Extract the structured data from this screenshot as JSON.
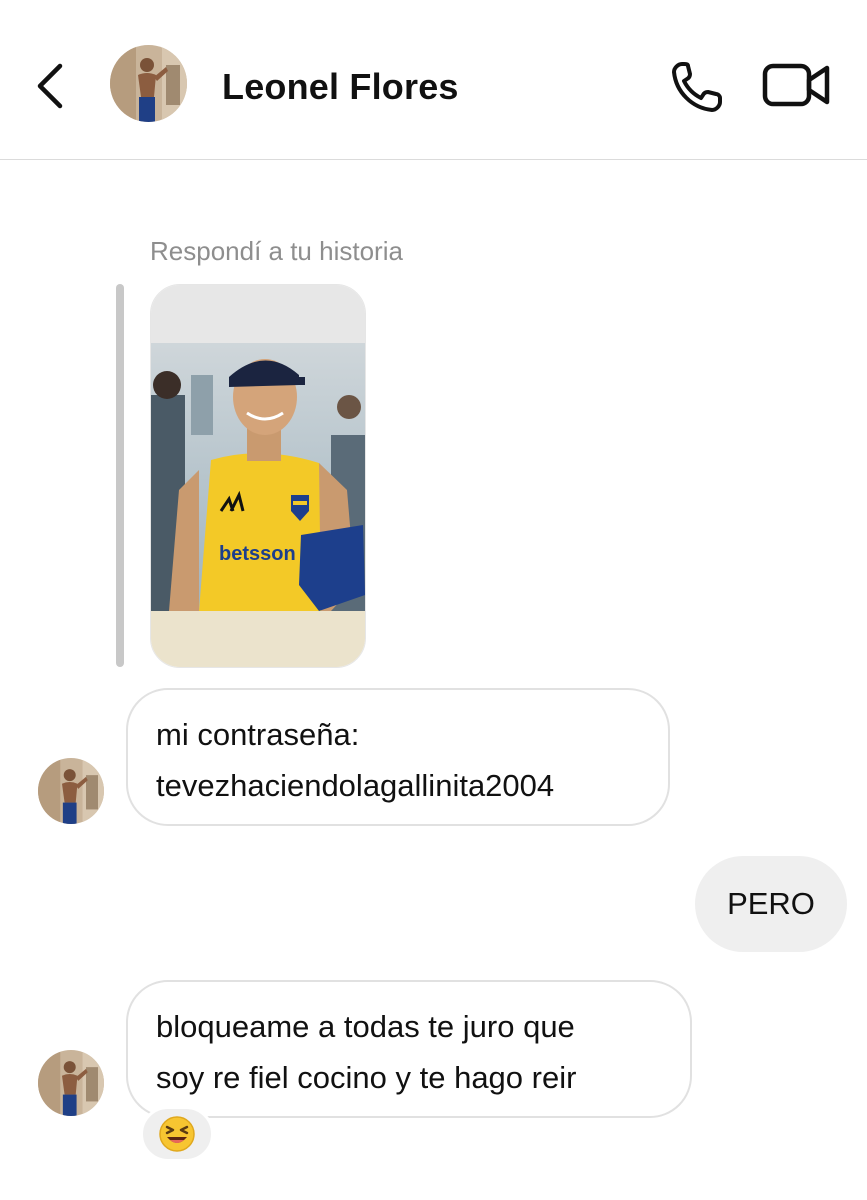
{
  "header": {
    "contact_name": "Leonel Flores",
    "back_icon": "chevron-left-icon",
    "call_icon": "phone-icon",
    "video_icon": "video-camera-icon"
  },
  "story_reply": {
    "caption": "Respondí a tu historia",
    "jersey_text": "betsson"
  },
  "messages": [
    {
      "direction": "incoming",
      "lines": [
        "mi contraseña:",
        "tevezhaciendolagallinita2004"
      ]
    },
    {
      "direction": "outgoing",
      "lines": [
        "PERO"
      ]
    },
    {
      "direction": "incoming",
      "lines": [
        "bloqueame a todas te juro que",
        "soy re fiel cocino y te hago reir"
      ],
      "reaction": "😆"
    }
  ],
  "colors": {
    "divider": "#dbdbdb",
    "caption": "#8e8e8e",
    "incoming_border": "#e1e1e1",
    "outgoing_bg": "#efefef",
    "reply_bar": "#c8c8c8",
    "jersey_yellow": "#f3c927",
    "jersey_blue": "#1d3f8c"
  }
}
